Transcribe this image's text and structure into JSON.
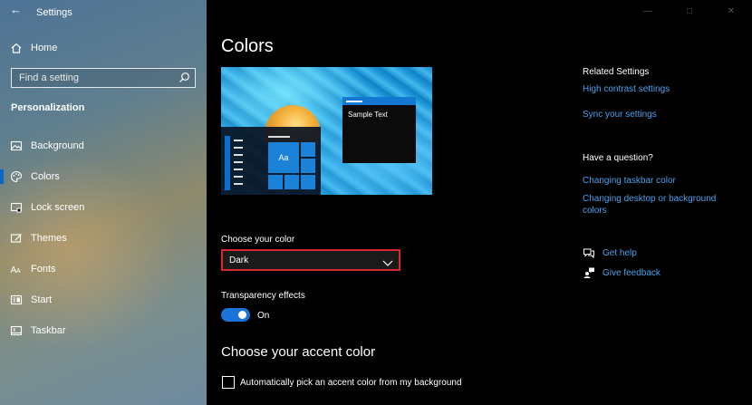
{
  "window": {
    "title": "Settings"
  },
  "sidebar": {
    "home_label": "Home",
    "search_placeholder": "Find a setting",
    "section_label": "Personalization",
    "items": [
      {
        "label": "Background",
        "icon": "picture-icon"
      },
      {
        "label": "Colors",
        "icon": "palette-icon",
        "active": true
      },
      {
        "label": "Lock screen",
        "icon": "lock-screen-icon"
      },
      {
        "label": "Themes",
        "icon": "themes-icon"
      },
      {
        "label": "Fonts",
        "icon": "fonts-icon"
      },
      {
        "label": "Start",
        "icon": "start-icon"
      },
      {
        "label": "Taskbar",
        "icon": "taskbar-icon"
      }
    ]
  },
  "main": {
    "title": "Colors",
    "preview": {
      "sample_text": "Sample Text",
      "tile_text": "Aa"
    },
    "choose_color": {
      "label": "Choose your color",
      "value": "Dark"
    },
    "transparency": {
      "label": "Transparency effects",
      "state": "On"
    },
    "accent_heading": "Choose your accent color",
    "auto_accent_label": "Automatically pick an accent color from my background"
  },
  "right": {
    "related_title": "Related Settings",
    "related_links": [
      "High contrast settings",
      "Sync your settings"
    ],
    "question_title": "Have a question?",
    "question_links": [
      "Changing taskbar color",
      "Changing desktop or background colors"
    ],
    "help_label": "Get help",
    "feedback_label": "Give feedback"
  },
  "colors": {
    "accent": "#1a73d8",
    "link": "#4ca0ea",
    "highlight_border": "#d9262f"
  }
}
